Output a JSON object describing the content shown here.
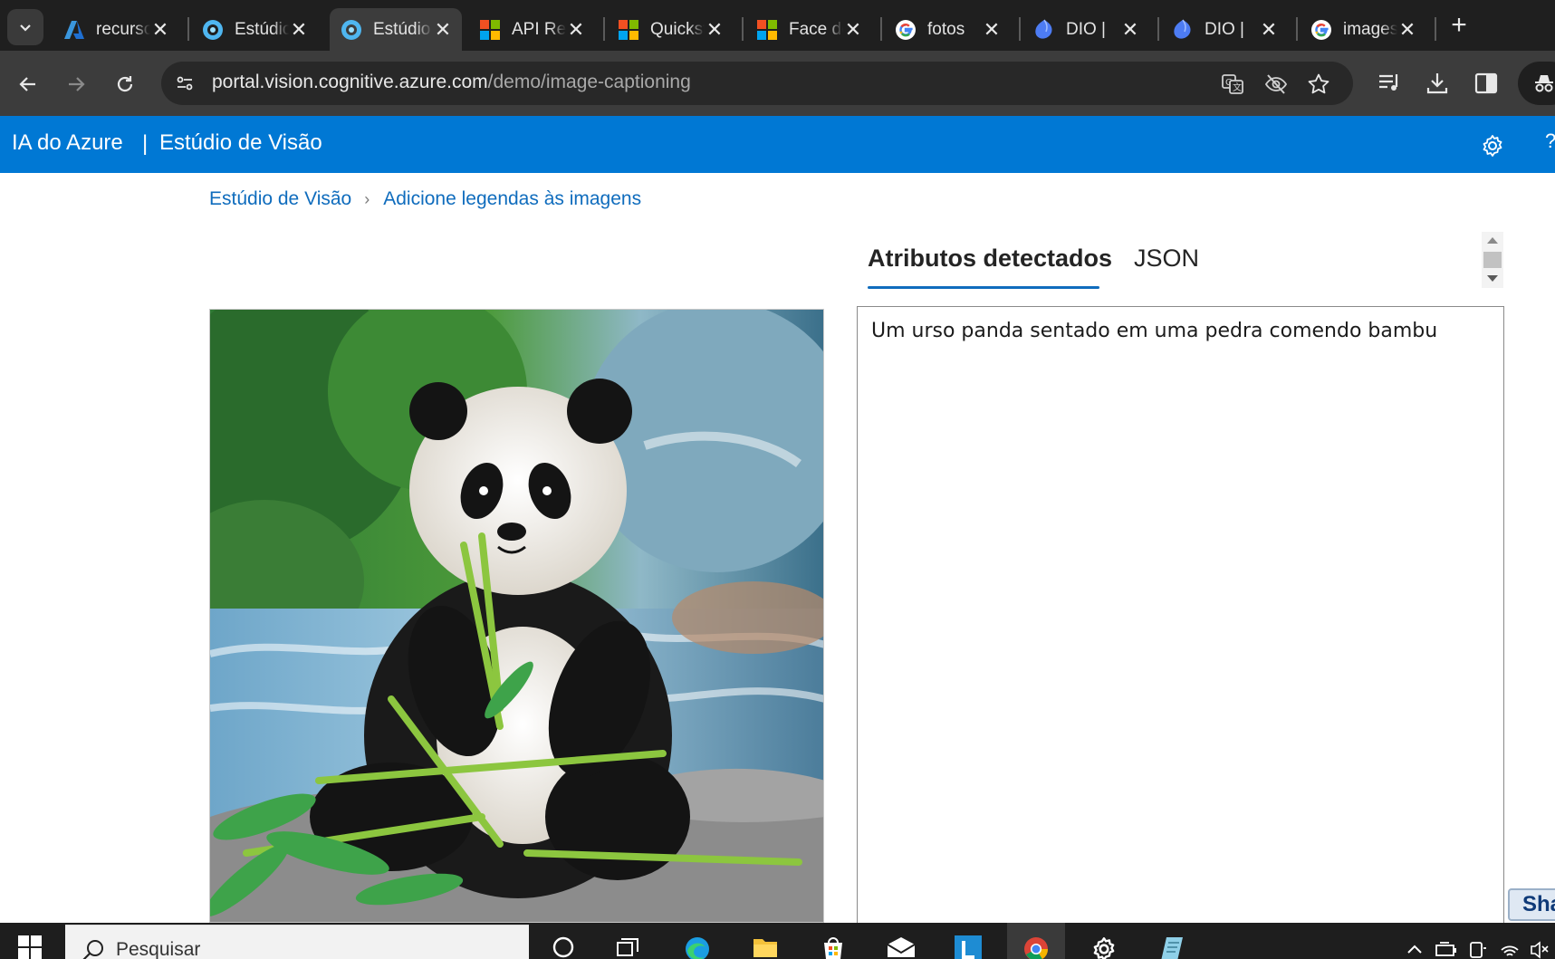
{
  "browser": {
    "tabs": [
      {
        "title": "recursos",
        "favicon": "azure-logo-icon",
        "active": false
      },
      {
        "title": "Estúdio de Visão",
        "favicon": "vision-studio-icon",
        "active": false
      },
      {
        "title": "Estúdio de Visão",
        "favicon": "vision-studio-icon",
        "active": true
      },
      {
        "title": "API Reference",
        "favicon": "microsoft-logo-icon",
        "active": false
      },
      {
        "title": "Quickstart",
        "favicon": "microsoft-logo-icon",
        "active": false
      },
      {
        "title": "Face detection",
        "favicon": "microsoft-logo-icon",
        "active": false
      },
      {
        "title": "fotos",
        "favicon": "google-logo-icon",
        "active": false
      },
      {
        "title": "DIO |",
        "favicon": "dio-logo-icon",
        "active": false
      },
      {
        "title": "DIO |",
        "favicon": "dio-logo-icon",
        "active": false
      },
      {
        "title": "images",
        "favicon": "google-logo-icon",
        "active": false
      }
    ],
    "close_glyph": "✕",
    "new_tab_glyph": "+",
    "url_host": "portal.vision.cognitive.azure.com",
    "url_path": "/demo/image-captioning"
  },
  "azure_header": {
    "brand": "IA do Azure",
    "separator": "|",
    "app_name": "Estúdio de Visão",
    "help_glyph": "?"
  },
  "breadcrumb": {
    "root": "Estúdio de Visão",
    "separator": "›",
    "current": "Adicione legendas às imagens"
  },
  "panel": {
    "tabs": [
      {
        "label": "Atributos detectados",
        "selected": true
      },
      {
        "label": "JSON",
        "selected": false
      }
    ],
    "caption": "Um urso panda sentado em uma pedra comendo bambu"
  },
  "share_button": {
    "label": "Share"
  },
  "taskbar": {
    "search_placeholder": "Pesquisar",
    "apps": [
      "cortana-icon",
      "task-view-icon",
      "edge-icon",
      "file-explorer-icon",
      "store-icon",
      "mail-icon",
      "app-l-icon",
      "chrome-icon",
      "settings-icon",
      "notepad-icon"
    ]
  },
  "colors": {
    "azure_blue": "#0078d4",
    "link_blue": "#0f6cbd",
    "chrome_dark": "#1f1f1f",
    "chrome_toolbar": "#3c3c3c"
  }
}
